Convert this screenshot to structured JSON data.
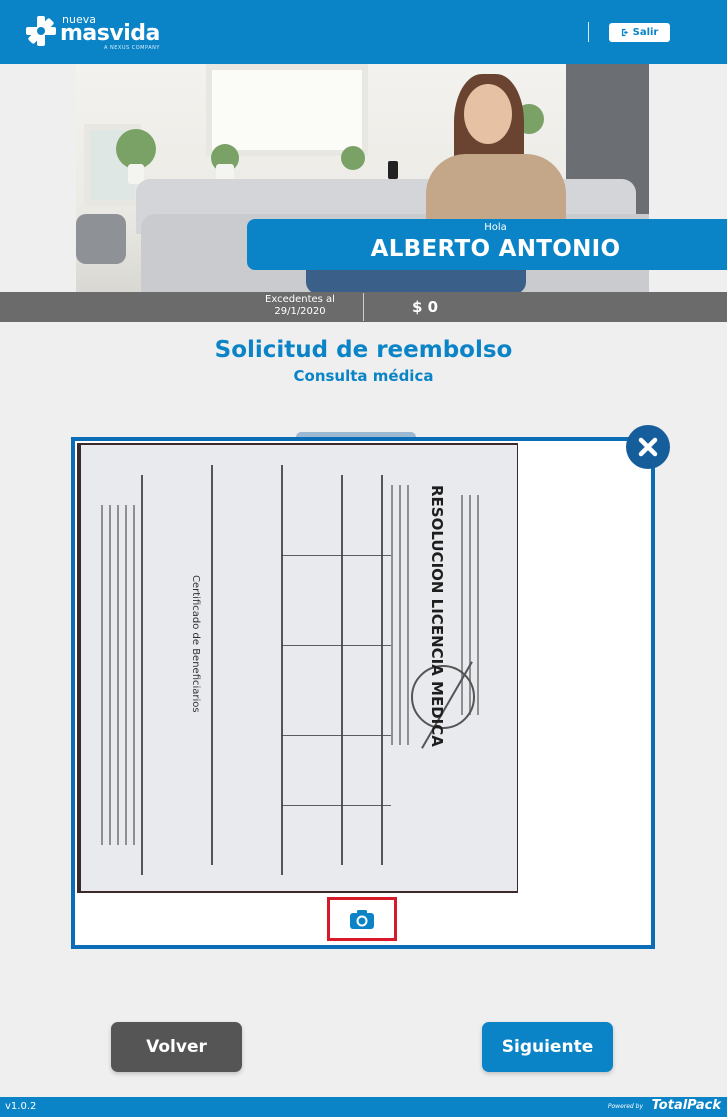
{
  "header": {
    "logo_small": "nueva",
    "logo_big": "masvida",
    "logo_tagline": "A NEXUS COMPANY",
    "logout_label": "Salir"
  },
  "hero": {
    "greeting": "Hola",
    "user_name": "ALBERTO ANTONIO",
    "excedentes_label": "Excedentes al",
    "excedentes_date": "29/1/2020",
    "amount": "$ 0"
  },
  "page": {
    "title": "Solicitud de reembolso",
    "subtitle": "Consulta médica"
  },
  "document_preview": {
    "heading": "RESOLUCION LICENCIA MEDICA",
    "section_label": "Certificado de Beneficiarios"
  },
  "actions": {
    "back_label": "Volver",
    "next_label": "Siguiente"
  },
  "footer": {
    "version": "v1.0.2",
    "powered_by": "Powered by",
    "brand": "TotalPack"
  },
  "colors": {
    "brand_blue": "#0a84c6",
    "modal_border": "#0a6db5",
    "close_button": "#165d9c",
    "highlight": "#d71a2a",
    "back_button": "#555555"
  }
}
